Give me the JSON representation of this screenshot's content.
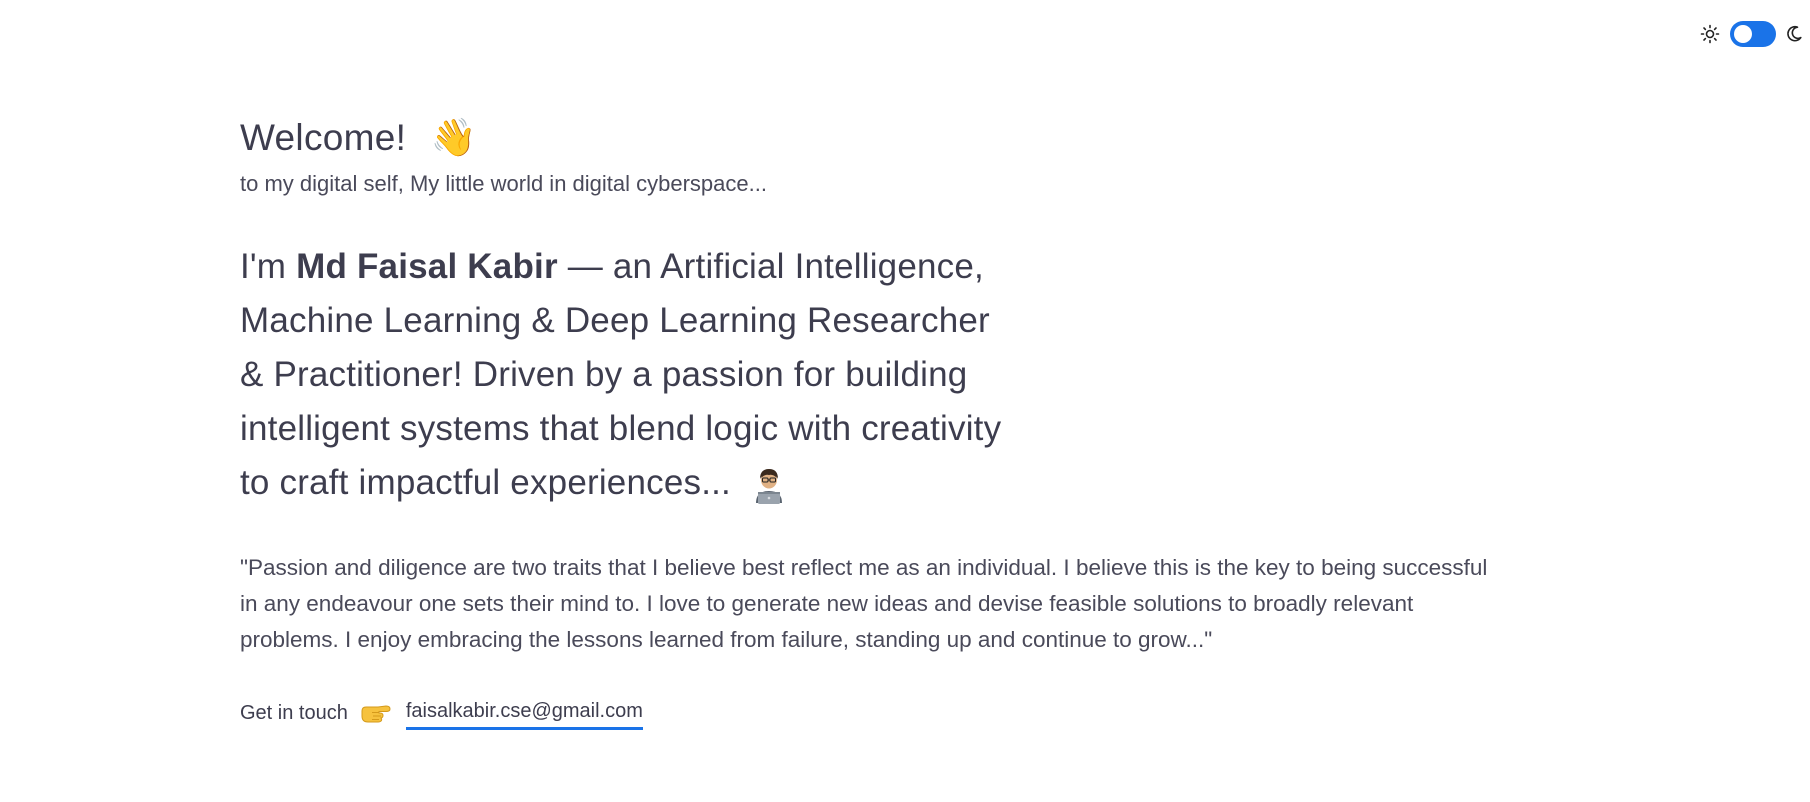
{
  "header": {
    "theme_toggle": {
      "light_icon": "sun-icon",
      "dark_icon": "moon-icon",
      "state": "light",
      "accent_color": "#1a73e8"
    }
  },
  "hero": {
    "welcome": "Welcome!",
    "welcome_emoji": "👋",
    "tagline": "to my digital self, My little world in digital cyberspace...",
    "intro_prefix": "I'm ",
    "name": "Md Faisal Kabir",
    "intro_suffix": " — an Artificial Intelligence, Machine Learning & Deep Learning Researcher & Practitioner! Driven by a passion for building intelligent systems that blend logic with creativity to craft impactful experiences...",
    "intro_emoji": "technologist-icon"
  },
  "quote": {
    "text": "\"Passion and diligence are two traits that I believe best reflect me as an individual. I believe this is the key to being successful in any endeavour one sets their mind to. I love to generate new ideas and devise feasible solutions to broadly relevant problems. I enjoy embracing the lessons learned from failure, standing up and continue to grow...\""
  },
  "contact": {
    "label": "Get in touch",
    "pointer_icon": "pointing-right-icon",
    "email": "faisalkabir.cse@gmail.com"
  }
}
